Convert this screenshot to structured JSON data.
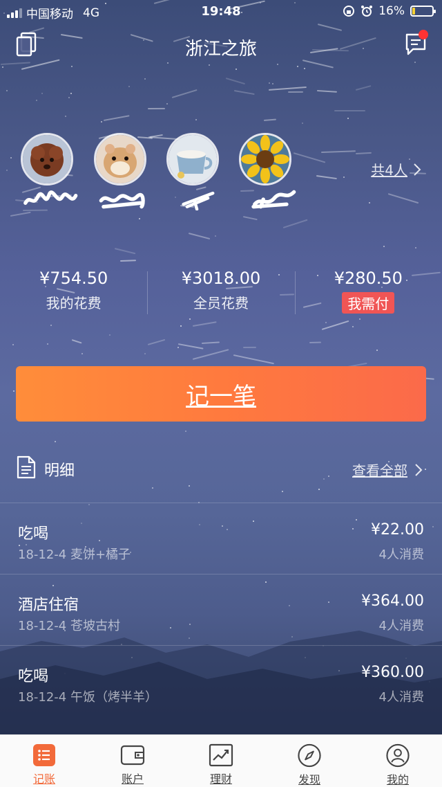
{
  "status_bar": {
    "carrier": "中国移动",
    "network": "4G",
    "time": "19:48",
    "battery": "16%",
    "battery_level": 0.16
  },
  "header": {
    "title": "浙江之旅",
    "has_notification": true
  },
  "members": {
    "count_label": "共4人",
    "avatars": [
      "poodle",
      "hamster",
      "coffee-cup",
      "sunflower"
    ]
  },
  "summary": {
    "my_spend": {
      "value": "¥754.50",
      "label": "我的花费"
    },
    "all_spend": {
      "value": "¥3018.00",
      "label": "全员花费"
    },
    "i_owe": {
      "value": "¥280.50",
      "label": "我需付"
    }
  },
  "record_button": {
    "label": "记一笔"
  },
  "details": {
    "title": "明细",
    "view_all": "查看全部",
    "items": [
      {
        "category": "吃喝",
        "desc": "18-12-4 麦饼+橘子",
        "amount": "¥22.00",
        "people": "4人消费"
      },
      {
        "category": "酒店住宿",
        "desc": "18-12-4 苍坡古村",
        "amount": "¥364.00",
        "people": "4人消费"
      },
      {
        "category": "吃喝",
        "desc": "18-12-4 午饭（烤半羊）",
        "amount": "¥360.00",
        "people": "4人消费"
      }
    ]
  },
  "tabbar": {
    "tabs": [
      {
        "label": "记账",
        "icon": "list-icon",
        "active": true
      },
      {
        "label": "账户",
        "icon": "wallet-icon",
        "active": false
      },
      {
        "label": "理财",
        "icon": "chart-icon",
        "active": false
      },
      {
        "label": "发现",
        "icon": "compass-icon",
        "active": false
      },
      {
        "label": "我的",
        "icon": "user-icon",
        "active": false
      }
    ]
  },
  "colors": {
    "accent": "#f26a3a",
    "button_start": "#ff8d3a",
    "button_end": "#fb6a4a",
    "owe_tag": "#f05555"
  }
}
